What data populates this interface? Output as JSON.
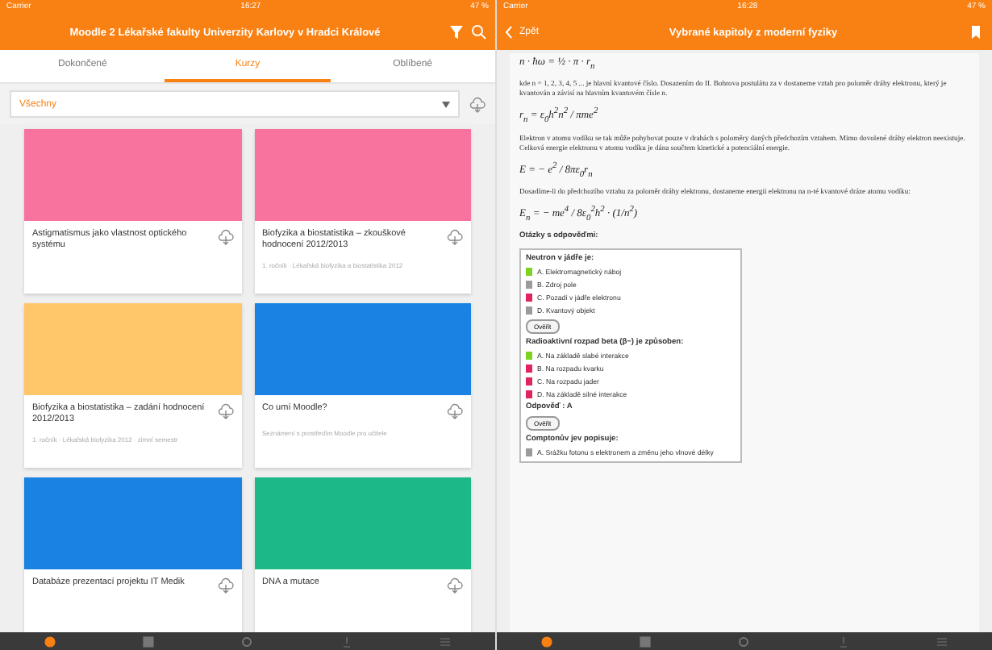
{
  "left": {
    "status_bar": {
      "carrier": "Carrier",
      "time": "16:27",
      "battery": "47 %"
    },
    "header": {
      "title": "Moodle 2 Lékařské fakulty Univerzity Karlovy v Hradci Králové"
    },
    "tabs": [
      {
        "label": "Dokončené",
        "selected": false
      },
      {
        "label": "Kurzy",
        "selected": true
      },
      {
        "label": "Oblíbené",
        "selected": false
      }
    ],
    "filter": {
      "value": "Všechny"
    },
    "courses": [
      {
        "title": "Astigmatismus jako vlastnost optického systému",
        "color": "#f9739f"
      },
      {
        "title": "Biofyzika a biostatistika – zkouškové hodnocení 2012/2013",
        "subtitle": "1. ročník · Lékařská biofyzika a biostatistika 2012",
        "color": "#f9739f"
      },
      {
        "title": "Biofyzika a biostatistika – zadání hodnocení 2012/2013",
        "subtitle": "1. ročník · Lékařská biofyzika 2012 · zimní semestr",
        "color": "#ffc66a"
      },
      {
        "title": "Co umí Moodle?",
        "subtitle": "Seznámení s prostředím Moodle pro učitele",
        "color": "#1a82e2"
      },
      {
        "title": "Databáze prezentací projektu IT Medik",
        "color": "#1a82e2"
      },
      {
        "title": "DNA a mutace",
        "color": "#1cb888"
      }
    ]
  },
  "right": {
    "status_bar": {
      "carrier": "Carrier",
      "time": "16:28",
      "battery": "47 %"
    },
    "header": {
      "back": "Zpět",
      "title": "Vybrané kapitoly z moderní fyziky"
    },
    "article": [
      {
        "kind": "formula",
        "text": "n · ħω = ½ · π · r$_{n}$"
      },
      {
        "kind": "text",
        "text": "kde n = 1, 2, 3, 4, 5 ... je hlavní kvantové číslo. Dosazením do II. Bohrova postulátu za v dostaneme vztah pro poloměr dráhy elektronu, který je kvantován a závisí na hlavním kvantovém čísle n."
      },
      {
        "kind": "formula",
        "text": "r$_{n}$ = ε$_{0}$h$^{2}$n$^{2}$ / πme$^{2}$"
      },
      {
        "kind": "text",
        "text": "Elektron v atomu vodíku se tak může pohybovat pouze v drahách s poloměry daných předchozím vztahem. Mimo dovolené dráhy elektron neexistuje. Celková energie elektronu v atomu vodíku je dána součtem kinetické a potenciální energie."
      },
      {
        "kind": "formula",
        "text": "E = − e$^{2}$ / 8πε$_{0}$r$_{n}$"
      },
      {
        "kind": "text",
        "text": "Dosadíme-li do předchozího vztahu za poloměr dráhy elektronu, dostaneme energii elektronu na n-té kvantové dráze atomu vodíku:"
      },
      {
        "kind": "formula",
        "text": "E$_{n}$ = − me$^{4}$ / 8ε$_{0}$$^{2}$h$^{2}$ · (1/n$^{2}$)"
      }
    ],
    "quiz": {
      "heading": "Otázky s odpověďmi:",
      "questions": [
        {
          "prompt": "Neutron v jádře je:",
          "options": [
            {
              "label": "A. Elektromagnetický náboj",
              "color": "#7ed321"
            },
            {
              "label": "B. Zdroj pole",
              "color": "#9b9b9b"
            },
            {
              "label": "C. Pozadí v jádře elektronu",
              "color": "#e0245e"
            },
            {
              "label": "D. Kvantový objekt",
              "color": "#9b9b9b"
            }
          ],
          "button": "Ověřit"
        },
        {
          "prompt": "Radioaktivní rozpad beta (β−) je způsoben:",
          "options": [
            {
              "label": "A. Na základě slabé interakce",
              "color": "#7ed321"
            },
            {
              "label": "B. Na rozpadu kvarku",
              "color": "#e0245e"
            },
            {
              "label": "C. Na rozpadu jader",
              "color": "#e0245e"
            },
            {
              "label": "D. Na základě silné interakce",
              "color": "#e0245e"
            }
          ],
          "answer": "Odpověď : A",
          "button": "Ověřit"
        },
        {
          "prompt": "Comptonův jev popisuje:",
          "options": [
            {
              "label": "A. Srážku fotonu s elektronem a změnu jeho vlnové délky",
              "color": "#9b9b9b"
            }
          ]
        }
      ]
    }
  },
  "tab_bars": [
    [
      {
        "selected": true
      },
      {
        "selected": false
      },
      {
        "selected": false
      },
      {
        "selected": false
      },
      {
        "selected": false
      }
    ],
    [
      {
        "selected": true
      },
      {
        "selected": false
      },
      {
        "selected": false
      },
      {
        "selected": false
      },
      {
        "selected": false
      }
    ]
  ]
}
